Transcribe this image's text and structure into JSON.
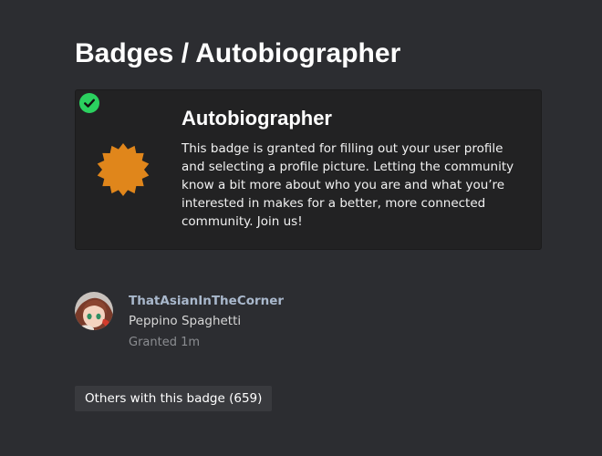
{
  "page": {
    "title": "Badges / Autobiographer"
  },
  "badge": {
    "name": "Autobiographer",
    "description": "This badge is granted for filling out your user profile and selecting a profile picture. Letting the community know a bit more about who you are and what you’re interested in makes for a better, more connected community. Join us!",
    "granted_status_icon": "check-circle-icon",
    "icon": "badge-burst-icon",
    "icon_color": "#e0861b",
    "check_color": "#2bd15f"
  },
  "grant": {
    "username": "ThatAsianInTheCorner",
    "full_name": "Peppino Spaghetti",
    "granted": "Granted 1m"
  },
  "others_button": {
    "label": "Others with this badge (659)"
  }
}
